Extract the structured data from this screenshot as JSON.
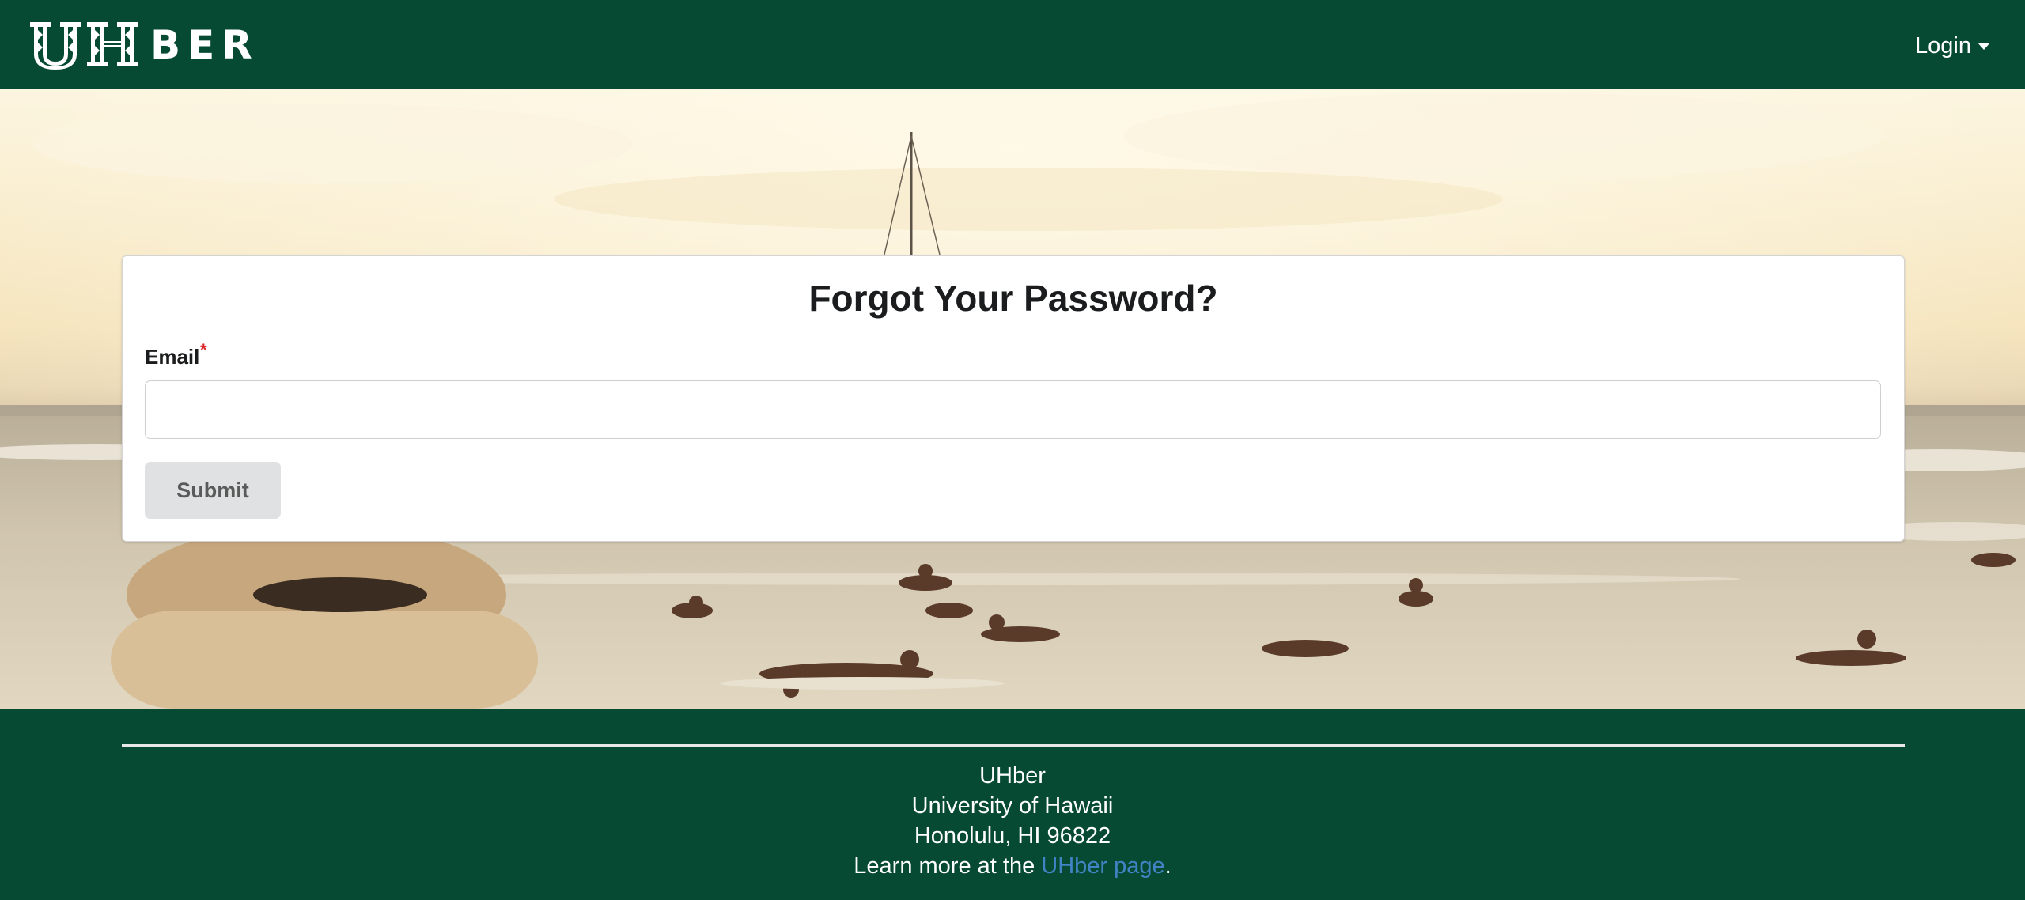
{
  "navbar": {
    "logo_text": "UHBER",
    "logo_suffix": "BER",
    "login_label": "Login"
  },
  "form": {
    "title": "Forgot Your Password?",
    "email_label": "Email",
    "required_mark": "*",
    "email_value": "",
    "email_placeholder": "",
    "submit_label": "Submit"
  },
  "footer": {
    "line1": "UHber",
    "line2": "University of Hawaii",
    "line3": "Honolulu, HI 96822",
    "line4_prefix": "Learn more at the ",
    "link_label": "UHber page",
    "line4_suffix": "."
  },
  "colors": {
    "brand_green": "#064a33",
    "link_blue": "#4183c4",
    "required_red": "#db2828",
    "button_gray": "#e0e1e2"
  },
  "icons": {
    "login_caret": "caret-down-icon"
  }
}
